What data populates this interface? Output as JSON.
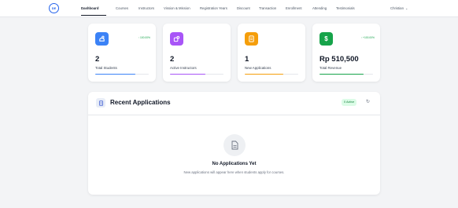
{
  "nav": {
    "logo_text": "DE",
    "items": [
      {
        "label": "Dashboard"
      },
      {
        "label": "Courses"
      },
      {
        "label": "Instructors"
      },
      {
        "label": "Vission & Mission"
      },
      {
        "label": "Registration Years"
      },
      {
        "label": "Discount"
      },
      {
        "label": "Transaction"
      },
      {
        "label": "Enrollment"
      },
      {
        "label": "Attending"
      },
      {
        "label": "Testimonials"
      }
    ],
    "user": "Christian"
  },
  "stats": [
    {
      "value": "2",
      "label": "Total Students",
      "badge": "↑ 100.00%",
      "icon": "student-icon",
      "color": "#3b82f6",
      "progress": 0.75
    },
    {
      "value": "2",
      "label": "Active Instructors",
      "badge": "",
      "icon": "instructor-icon",
      "color": "#a855f7",
      "progress": 0.66
    },
    {
      "value": "1",
      "label": "New Applications",
      "badge": "",
      "icon": "document-icon",
      "color": "#f59e0b",
      "progress": 0.72
    },
    {
      "value": "Rp 510,500",
      "label": "Total Revenue",
      "badge": "↑ +100.00%",
      "icon": "dollar-icon",
      "color": "#16a34a",
      "progress": 0.82
    }
  ],
  "recent": {
    "title": "Recent Applications",
    "badge": "0 Active",
    "empty_title": "No Applications Yet",
    "empty_text": "New applications will appear here when students apply for courses."
  }
}
